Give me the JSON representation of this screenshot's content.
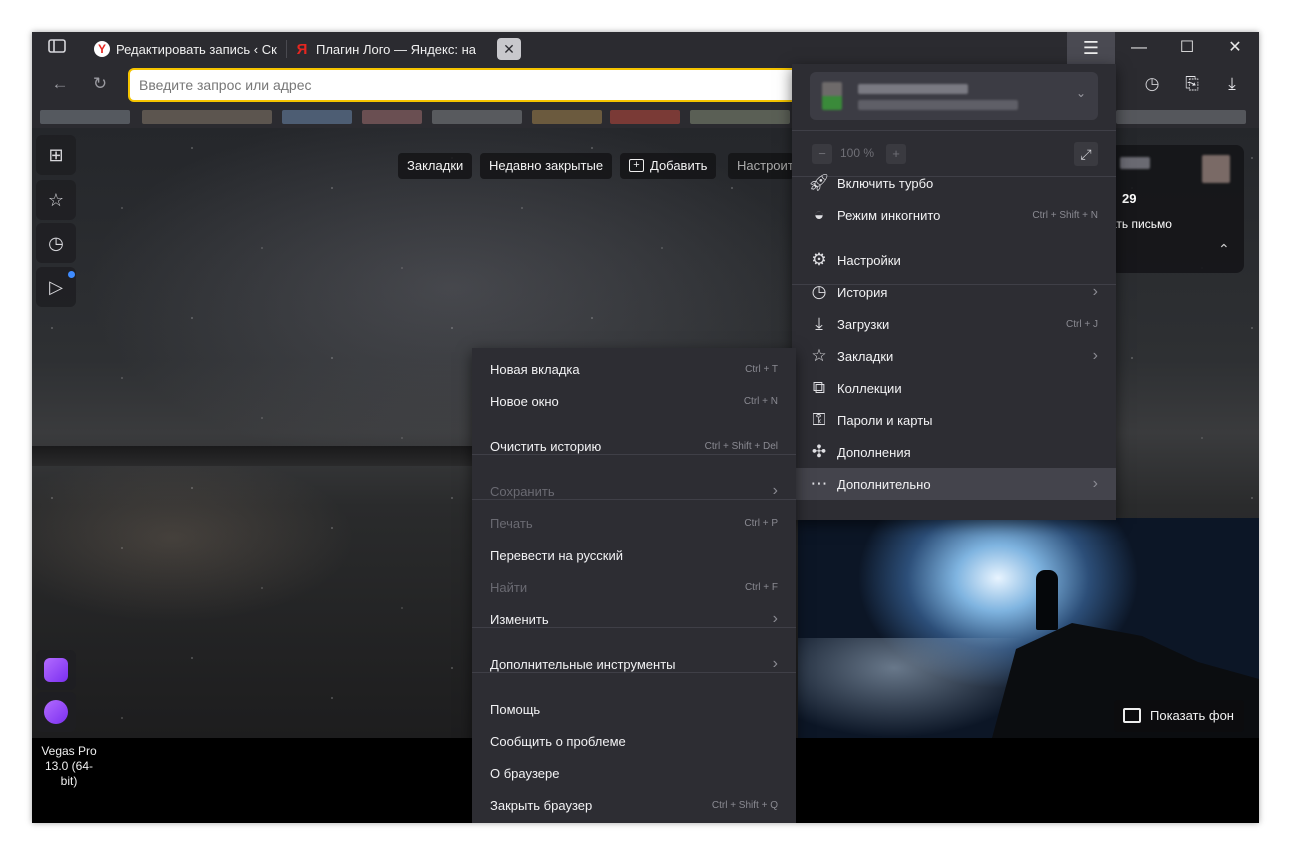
{
  "tabs": [
    {
      "title": "Редактировать запись ‹ Ск"
    },
    {
      "title": "Плагин Лого — Яндекс: на"
    }
  ],
  "toolbar": {
    "address_placeholder": "Введите запрос или адрес"
  },
  "newtab": {
    "pills": [
      "Закладки",
      "Недавно закрытые",
      "Добавить",
      "Настроит"
    ],
    "mail_count": "29",
    "mail_action": "ать письмо",
    "show_background": "Показать фон"
  },
  "desktop": {
    "icon_label_1": "Vegas Pro",
    "icon_label_2": "13.0 (64-bit)"
  },
  "main_menu": {
    "zoom": "100 %",
    "items": [
      {
        "label": "Включить турбо",
        "shortcut": "",
        "arrow": false,
        "icon": "rocket-icon"
      },
      {
        "label": "Режим инкогнито",
        "shortcut": "Ctrl + Shift + N",
        "arrow": false,
        "icon": "incognito-mask-icon"
      },
      {
        "label": "Настройки",
        "shortcut": "",
        "arrow": false,
        "icon": "gear-icon"
      },
      {
        "label": "История",
        "shortcut": "",
        "arrow": true,
        "icon": "clock-icon"
      },
      {
        "label": "Загрузки",
        "shortcut": "Ctrl + J",
        "arrow": false,
        "icon": "download-icon"
      },
      {
        "label": "Закладки",
        "shortcut": "",
        "arrow": true,
        "icon": "star-icon"
      },
      {
        "label": "Коллекции",
        "shortcut": "",
        "arrow": false,
        "icon": "collections-icon"
      },
      {
        "label": "Пароли и карты",
        "shortcut": "",
        "arrow": false,
        "icon": "key-card-icon"
      },
      {
        "label": "Дополнения",
        "shortcut": "",
        "arrow": false,
        "icon": "puzzle-icon"
      },
      {
        "label": "Дополнительно",
        "shortcut": "",
        "arrow": true,
        "icon": "more-dots-icon"
      }
    ]
  },
  "submenu": {
    "items": [
      {
        "label": "Новая вкладка",
        "shortcut": "Ctrl + T",
        "disabled": false,
        "arrow": false
      },
      {
        "label": "Новое окно",
        "shortcut": "Ctrl + N",
        "disabled": false,
        "arrow": false
      },
      {
        "label": "Очистить историю",
        "shortcut": "Ctrl + Shift + Del",
        "disabled": false,
        "arrow": false
      },
      {
        "label": "Сохранить",
        "shortcut": "",
        "disabled": true,
        "arrow": true
      },
      {
        "label": "Печать",
        "shortcut": "Ctrl + P",
        "disabled": true,
        "arrow": false
      },
      {
        "label": "Перевести на русский",
        "shortcut": "",
        "disabled": false,
        "arrow": false
      },
      {
        "label": "Найти",
        "shortcut": "Ctrl + F",
        "disabled": true,
        "arrow": false
      },
      {
        "label": "Изменить",
        "shortcut": "",
        "disabled": false,
        "arrow": true
      },
      {
        "label": "Дополнительные инструменты",
        "shortcut": "",
        "disabled": false,
        "arrow": true
      },
      {
        "label": "Помощь",
        "shortcut": "",
        "disabled": false,
        "arrow": false
      },
      {
        "label": "Сообщить о проблеме",
        "shortcut": "",
        "disabled": false,
        "arrow": false
      },
      {
        "label": "О браузере",
        "shortcut": "",
        "disabled": false,
        "arrow": false
      },
      {
        "label": "Закрыть браузер",
        "shortcut": "Ctrl + Shift + Q",
        "disabled": false,
        "arrow": false
      }
    ]
  },
  "colors": {
    "accent_yellow": "#f5c400",
    "menu_bg": "#2d2d33",
    "tabbar_bg": "#2b2b30",
    "alice_purple": "#8a3ffc"
  }
}
